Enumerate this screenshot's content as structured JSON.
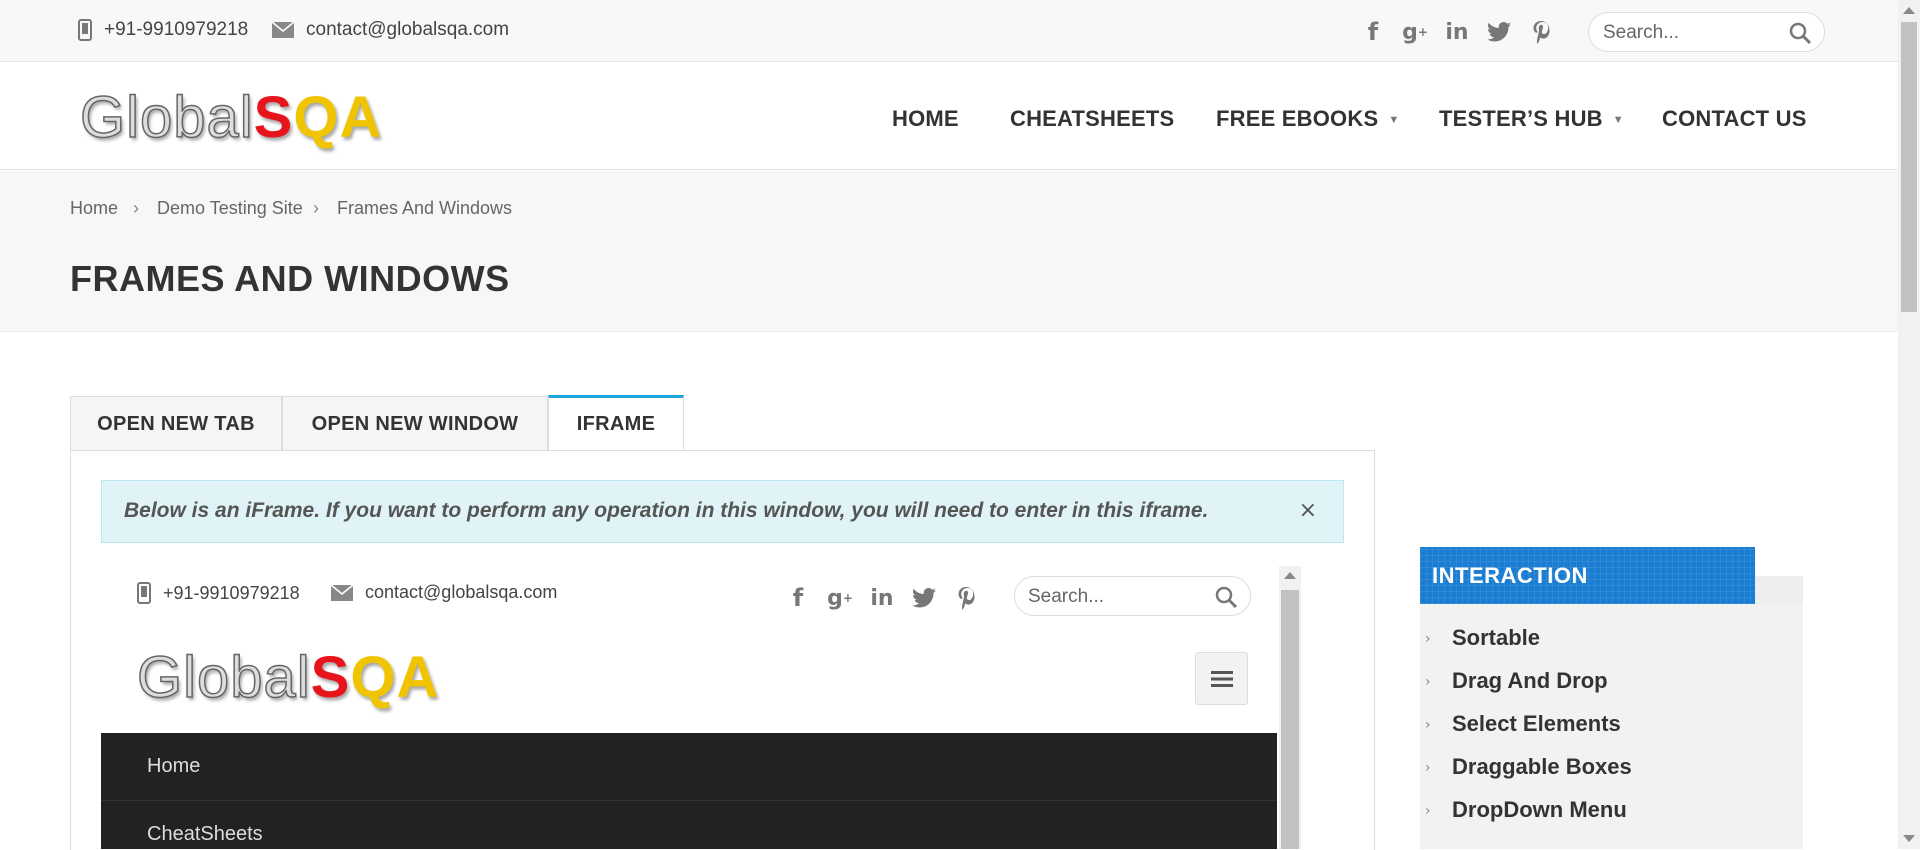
{
  "topbar": {
    "phone": "+91-9910979218",
    "email": "contact@globalsqa.com",
    "social": [
      "facebook-icon",
      "google-plus-icon",
      "linkedin-icon",
      "twitter-icon",
      "pinterest-icon"
    ],
    "search_placeholder": "Search..."
  },
  "logo": {
    "part1": "Global",
    "part2": "S",
    "part3": "QA"
  },
  "nav": {
    "home": "HOME",
    "cheatsheets": "CHEATSHEETS",
    "free_ebooks": "FREE EBOOKS",
    "testers_hub": "TESTER’S HUB",
    "contact": "CONTACT US"
  },
  "breadcrumb": {
    "home": "Home",
    "demo": "Demo Testing Site",
    "current": "Frames And Windows",
    "sep": "›"
  },
  "page_title": "FRAMES AND WINDOWS",
  "tabs": {
    "tab1": "OPEN NEW TAB",
    "tab2": "OPEN NEW WINDOW",
    "tab3": "IFRAME",
    "active": "IFRAME"
  },
  "alert": {
    "message": "Below is an iFrame. If you want to perform any operation in this window, you will need to enter in this iframe.",
    "close": "×"
  },
  "iframe": {
    "phone": "+91-9910979218",
    "email": "contact@globalsqa.com",
    "search_placeholder": "Search...",
    "menu": [
      "Home",
      "CheatSheets"
    ]
  },
  "sidebar": {
    "title": "INTERACTION",
    "items": [
      "Sortable",
      "Drag And Drop",
      "Select Elements",
      "Draggable Boxes",
      "DropDown Menu"
    ]
  },
  "colors": {
    "accent": "#1ca8dd",
    "widget_blue": "#1a7dd2",
    "logo_red": "#e8141b",
    "logo_yellow": "#f0c400",
    "iframe_menu_bg": "#222222"
  }
}
